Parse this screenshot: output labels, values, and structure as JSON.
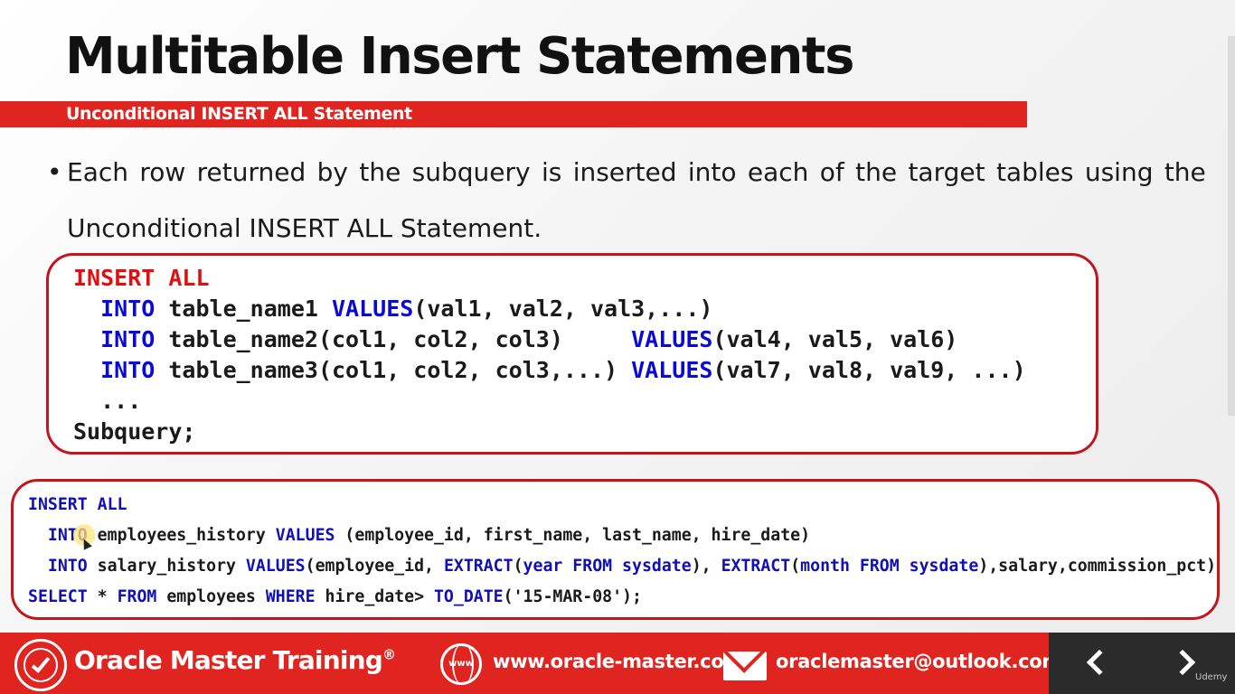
{
  "slide": {
    "title": "Multitable Insert Statements",
    "subtitle": "Unconditional INSERT ALL Statement",
    "bullet_char": "•",
    "bullet_words": [
      "Each",
      "row",
      "returned",
      "by",
      "the",
      "subquery",
      "is",
      "inserted",
      "into",
      "each",
      "of",
      "the",
      "target",
      "tables",
      "using",
      "the"
    ],
    "bullet_line2": "Unconditional INSERT ALL Statement."
  },
  "syntax_box": {
    "line1": {
      "kw": "INSERT ALL"
    },
    "line2": {
      "indent": "  ",
      "kw1": "INTO",
      "text1": " table_name1 ",
      "kw2": "VALUES",
      "text2": "(val1, val2, val3,...)"
    },
    "line3": {
      "indent": "  ",
      "kw1": "INTO",
      "text1": " table_name2(col1, col2, col3)     ",
      "kw2": "VALUES",
      "text2": "(val4, val5, val6)"
    },
    "line4": {
      "indent": "  ",
      "kw1": "INTO",
      "text1": " table_name3(col1, col2, col3,...) ",
      "kw2": "VALUES",
      "text2": "(val7, val8, val9, ...)"
    },
    "line5": {
      "text": "  ..."
    },
    "line6": {
      "text": "Subquery;"
    }
  },
  "example_box": {
    "line1": {
      "kw": "INSERT ALL"
    },
    "line2": {
      "indent": "  ",
      "kw1": "INTO",
      "t1": " employees_history ",
      "kw2": "VALUES",
      "t2": " (employee_id, first_name, last_name, hire_date)"
    },
    "line3": {
      "indent": "  ",
      "kw1": "INTO",
      "t1": " salary_history ",
      "kw2": "VALUES",
      "t2": "(employee_id, ",
      "kw3": "EXTRACT",
      "t3": "(",
      "kw4": "year FROM sysdate",
      "t4": "), ",
      "kw5": "EXTRACT",
      "t5": "(",
      "kw6": "month FROM sysdate",
      "t6": "),salary,commission_pct)"
    },
    "line4": {
      "kw1": "SELECT",
      "t1": " * ",
      "kw2": "FROM",
      "t2": " employees ",
      "kw3": "WHERE",
      "t3": " hire_date> ",
      "kw4": "TO_DATE",
      "t4": "('15-MAR-08');"
    }
  },
  "footer": {
    "brand": "Oracle Master Training",
    "brand_mark": "®",
    "globe_label": "www",
    "website": "www.oracle-master.com",
    "email": "oraclemaster@outlook.com",
    "watermark": "Udemy"
  },
  "colors": {
    "accent_red": "#e02521",
    "keyword_red": "#e01010",
    "keyword_blue": "#0a0ad8",
    "footer_dark": "#2b2b2b"
  },
  "icons": {
    "badge": "certified-badge-icon",
    "globe": "globe-icon",
    "mail": "mail-icon",
    "prev": "chevron-left-icon",
    "next": "chevron-right-icon"
  }
}
